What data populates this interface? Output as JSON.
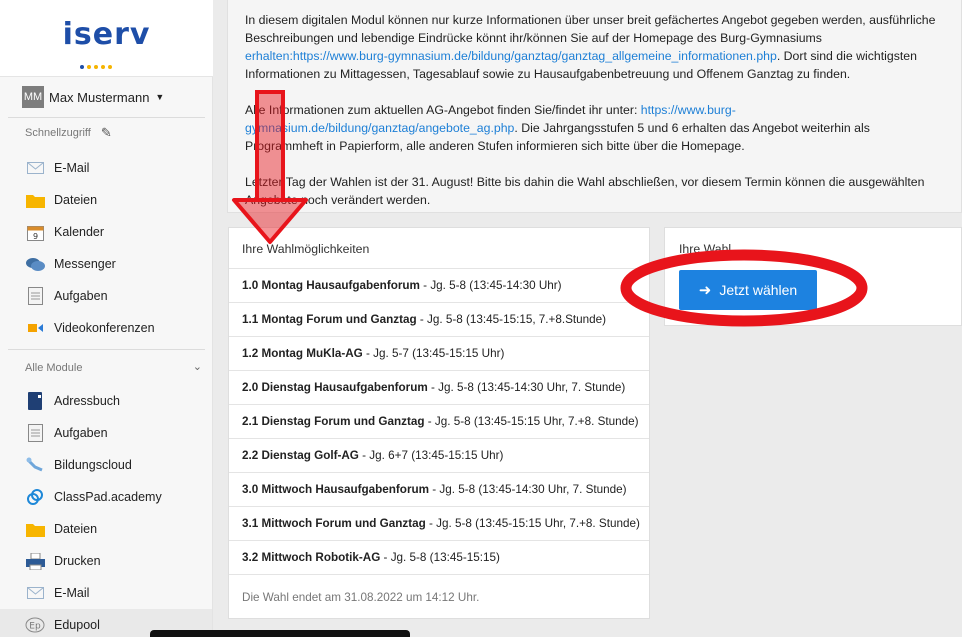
{
  "logo": {
    "text": "iserv"
  },
  "user": {
    "initials": "MM",
    "name": "Max Mustermann"
  },
  "quick_access": {
    "label": "Schnellzugriff",
    "items": [
      {
        "label": "E-Mail",
        "icon": "mail-icon"
      },
      {
        "label": "Dateien",
        "icon": "folder-icon"
      },
      {
        "label": "Kalender",
        "icon": "calendar-icon"
      },
      {
        "label": "Messenger",
        "icon": "chat-icon"
      },
      {
        "label": "Aufgaben",
        "icon": "tasks-icon"
      },
      {
        "label": "Videokonferenzen",
        "icon": "video-icon"
      }
    ]
  },
  "all_modules": {
    "label": "Alle Module",
    "items": [
      {
        "label": "Adressbuch",
        "icon": "addressbook-icon"
      },
      {
        "label": "Aufgaben",
        "icon": "tasks-icon"
      },
      {
        "label": "Bildungscloud",
        "icon": "cloud-icon"
      },
      {
        "label": "ClassPad.academy",
        "icon": "classpad-icon"
      },
      {
        "label": "Dateien",
        "icon": "folder-icon"
      },
      {
        "label": "Drucken",
        "icon": "printer-icon"
      },
      {
        "label": "E-Mail",
        "icon": "mail-icon"
      },
      {
        "label": "Edupool",
        "icon": "edupool-icon"
      }
    ]
  },
  "info": {
    "p1_a": "In diesem digitalen Modul können nur kurze Informationen über unser breit gefächertes Angebot gegeben werden, ausführliche Beschreibungen und lebendige Eindrücke könnt ihr/können Sie auf der Homepage des Burg-Gymnasiums ",
    "p1_link": "erhalten:https://www.burg-gymnasium.de/bildung/ganztag/ganztag_allgemeine_informationen.php",
    "p1_b": ". Dort sind die wichtigsten Informationen zu Mittagessen, Tagesablauf sowie zu Hausaufgabenbetreuung und Offenem Ganztag zu finden.",
    "p2_a": "Alle Informationen zum aktuellen AG-Angebot finden Sie/findet ihr unter: ",
    "p2_link": "https://www.burg-gymnasium.de/bildung/ganztag/angebote_ag.php",
    "p2_b": ". Die Jahrgangsstufen 5 und 6 erhalten das Angebot weiterhin als Programmheft in Papierform, alle anderen Stufen informieren sich bitte über die Homepage.",
    "p3": "Letzter Tag der Wahlen ist der 31. August! Bitte bis dahin die Wahl abschließen, vor diesem Termin können die ausgewählten Angebote noch verändert werden."
  },
  "choices": {
    "title": "Ihre Wahlmöglichkeiten",
    "items": [
      {
        "name": "1.0 Montag Hausaufgabenforum",
        "detail": " - Jg. 5-8 (13:45-14:30 Uhr)"
      },
      {
        "name": "1.1 Montag Forum und Ganztag",
        "detail": " - Jg. 5-8 (13:45-15:15, 7.+8.Stunde)"
      },
      {
        "name": "1.2 Montag MuKla-AG",
        "detail": " - Jg. 5-7 (13:45-15:15 Uhr)"
      },
      {
        "name": "2.0 Dienstag Hausaufgabenforum",
        "detail": " - Jg. 5-8 (13:45-14:30 Uhr, 7. Stunde)"
      },
      {
        "name": "2.1 Dienstag Forum und Ganztag",
        "detail": " - Jg. 5-8 (13:45-15:15 Uhr, 7.+8. Stunde)"
      },
      {
        "name": "2.2 Dienstag Golf-AG",
        "detail": " - Jg. 6+7 (13:45-15:15 Uhr)"
      },
      {
        "name": "3.0 Mittwoch Hausaufgabenforum",
        "detail": " - Jg. 5-8 (13:45-14:30 Uhr, 7. Stunde)"
      },
      {
        "name": "3.1 Mittwoch Forum und Ganztag",
        "detail": " - Jg. 5-8 (13:45-15:15 Uhr, 7.+8. Stunde)"
      },
      {
        "name": "3.2 Mittwoch Robotik-AG",
        "detail": " - Jg. 5-8 (13:45-15:15)"
      }
    ],
    "footer": "Die Wahl endet am 31.08.2022 um 14:12 Uhr."
  },
  "vote": {
    "title": "Ihre Wahl",
    "button": "Jetzt wählen"
  },
  "colors": {
    "accent": "#1d82e0",
    "link": "#1d7fd6",
    "annotation": "#e8141b",
    "logo": "#1e4ea8"
  }
}
